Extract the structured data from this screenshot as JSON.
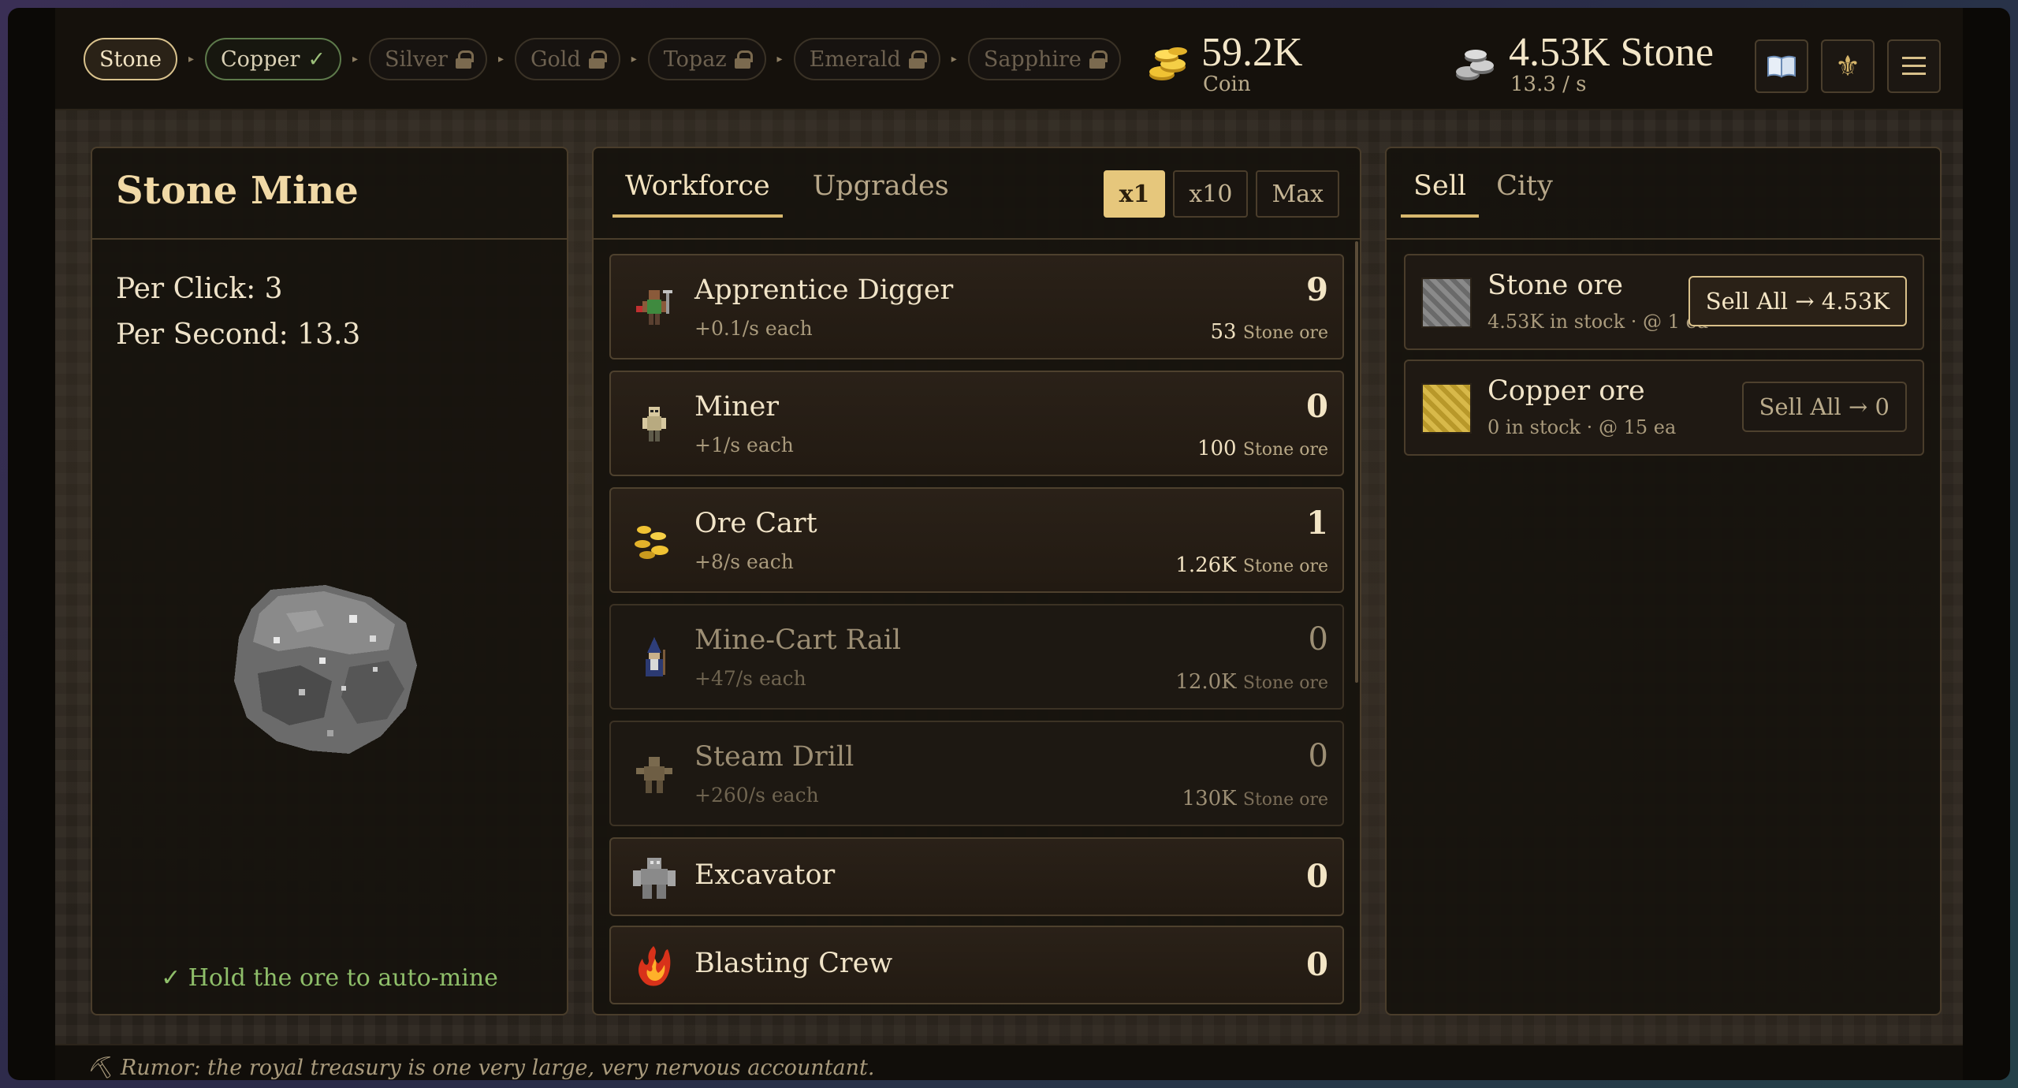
{
  "tiers": [
    {
      "label": "Stone",
      "state": "active"
    },
    {
      "label": "Copper",
      "state": "done",
      "mark": "✓"
    },
    {
      "label": "Silver",
      "state": "locked"
    },
    {
      "label": "Gold",
      "state": "locked"
    },
    {
      "label": "Topaz",
      "state": "locked"
    },
    {
      "label": "Emerald",
      "state": "locked"
    },
    {
      "label": "Sapphire",
      "state": "locked"
    }
  ],
  "resources": {
    "coin": {
      "value": "59.2K",
      "label": "Coin",
      "icon": "gold-coins-icon"
    },
    "stone": {
      "value": "4.53K Stone",
      "rate": "13.3 / s",
      "icon": "stone-pile-icon"
    }
  },
  "toolbar": {
    "book_icon": "book-icon",
    "fleur_icon": "fleur-de-lis-icon",
    "menu_icon": "hamburger-menu-icon"
  },
  "mine": {
    "title": "Stone Mine",
    "per_click": "Per Click: 3",
    "per_second": "Per Second: 13.3",
    "hint": "✓ Hold the ore to auto-mine"
  },
  "workforce": {
    "tabs": [
      "Workforce",
      "Upgrades"
    ],
    "multipliers": [
      "x1",
      "x10",
      "Max"
    ],
    "units": [
      {
        "name": "Apprentice Digger",
        "rate": "+0.1/s each",
        "count": "9",
        "cost": "53",
        "cost_unit": "Stone ore",
        "icon": "digger-icon",
        "dim": false
      },
      {
        "name": "Miner",
        "rate": "+1/s each",
        "count": "0",
        "cost": "100",
        "cost_unit": "Stone ore",
        "icon": "miner-icon",
        "dim": false
      },
      {
        "name": "Ore Cart",
        "rate": "+8/s each",
        "count": "1",
        "cost": "1.26K",
        "cost_unit": "Stone ore",
        "icon": "coins-cart-icon",
        "dim": false
      },
      {
        "name": "Mine-Cart Rail",
        "rate": "+47/s each",
        "count": "0",
        "cost": "12.0K",
        "cost_unit": "Stone ore",
        "icon": "wizard-icon",
        "dim": true
      },
      {
        "name": "Steam Drill",
        "rate": "+260/s each",
        "count": "0",
        "cost": "130K",
        "cost_unit": "Stone ore",
        "icon": "golem-icon",
        "dim": true
      },
      {
        "name": "Excavator",
        "count": "0",
        "icon": "stone-golem-icon",
        "dim": false
      },
      {
        "name": "Blasting Crew",
        "count": "0",
        "icon": "fire-elemental-icon",
        "dim": false
      }
    ]
  },
  "market": {
    "tabs": [
      "Sell",
      "City"
    ],
    "items": [
      {
        "name": "Stone ore",
        "sub": "4.53K in stock · @ 1 ea",
        "button": "Sell All → 4.53K",
        "color": "#7d7d7d",
        "active": true
      },
      {
        "name": "Copper ore",
        "sub": "0 in stock · @ 15 ea",
        "button": "Sell All → 0",
        "color": "#c9a93a",
        "active": false
      }
    ]
  },
  "footer": {
    "text": "⛏ Rumor: the royal treasury is one very large, very nervous accountant."
  }
}
